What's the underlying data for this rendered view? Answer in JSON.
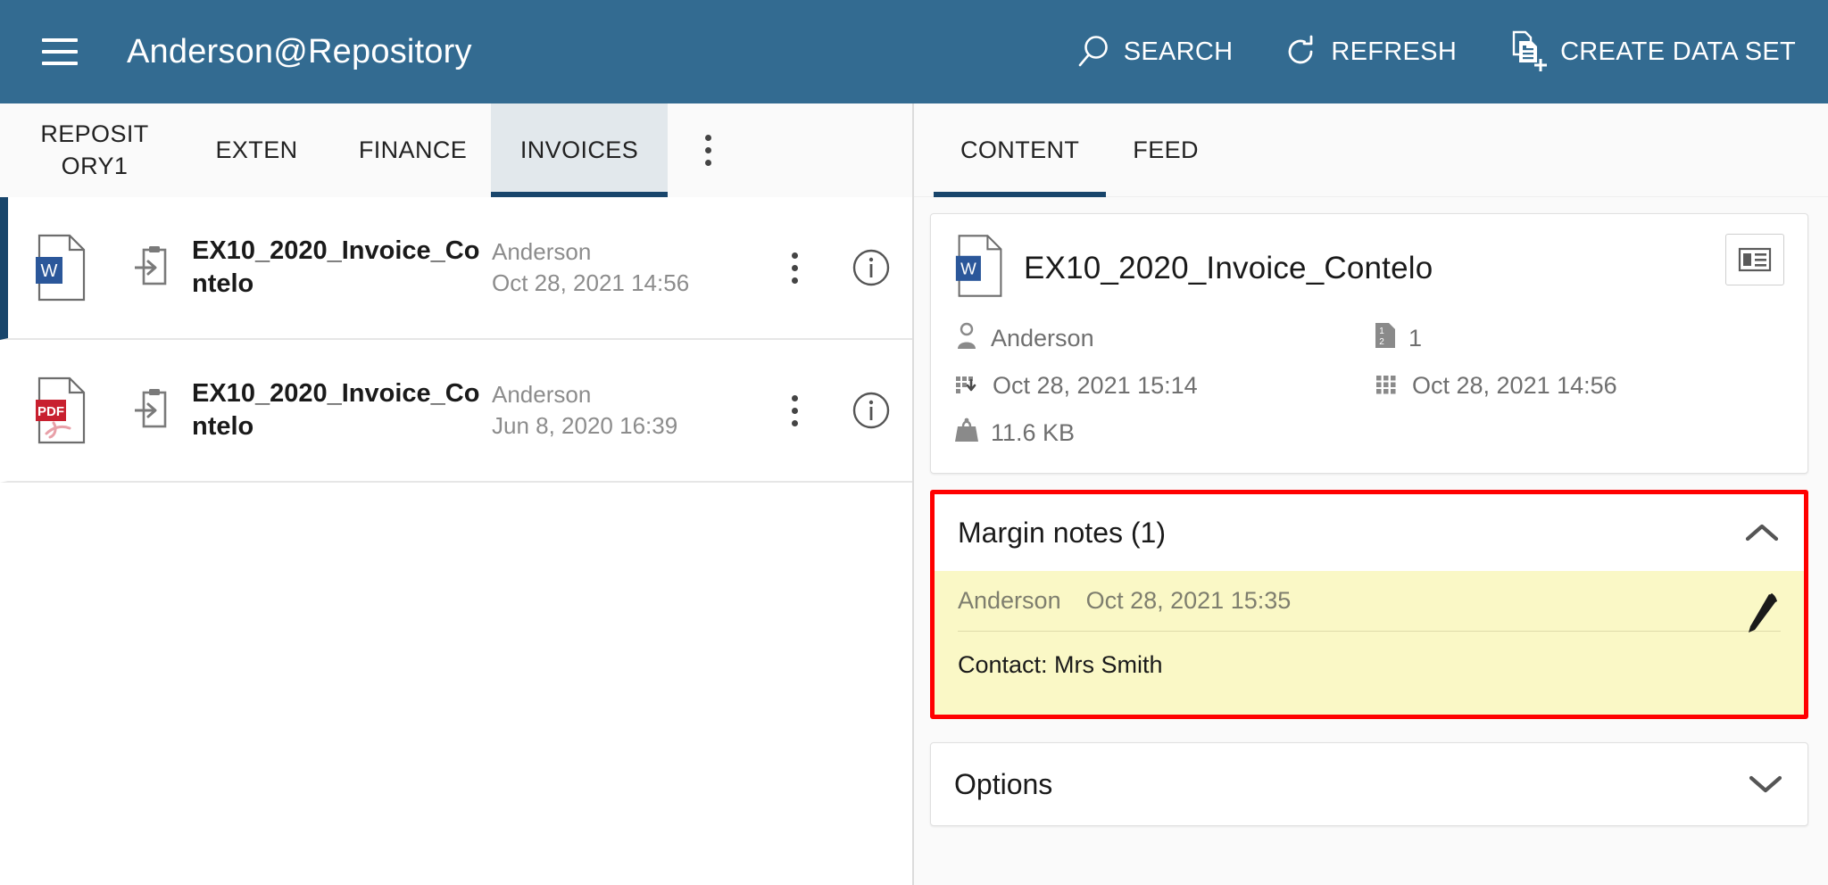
{
  "app": {
    "title": "Anderson@Repository",
    "menu_icon": "hamburger-icon",
    "actions": [
      {
        "label": "SEARCH",
        "icon": "search-icon"
      },
      {
        "label": "REFRESH",
        "icon": "refresh-icon"
      },
      {
        "label": "CREATE DATA SET",
        "icon": "create-data-set-icon"
      }
    ],
    "header_color": "#336B91",
    "accent_color": "#18456B",
    "highlight_color": "#FF0000",
    "note_color": "#FAF8C6"
  },
  "left_pane": {
    "tabs": [
      {
        "label": "REPOSITORY1",
        "active": false
      },
      {
        "label": "EXTEN",
        "active": false
      },
      {
        "label": "FINANCE",
        "active": false
      },
      {
        "label": "INVOICES",
        "active": true
      }
    ],
    "overflow_icon": "more-vertical-icon",
    "files": [
      {
        "type_icon": "word-file-icon",
        "type_label": "W",
        "state_icon": "check-in-icon",
        "name": "EX10_2020_Invoice_Contelo",
        "author": "Anderson",
        "modified": "Oct 28, 2021 14:56",
        "selected": true
      },
      {
        "type_icon": "pdf-file-icon",
        "type_label": "PDF",
        "state_icon": "check-in-icon",
        "name": "EX10_2020_Invoice_Contelo",
        "author": "Anderson",
        "modified": "Jun 8, 2020 16:39",
        "selected": false
      }
    ]
  },
  "right_pane": {
    "tabs": [
      {
        "label": "CONTENT",
        "active": true
      },
      {
        "label": "FEED",
        "active": false
      }
    ],
    "detail": {
      "type_icon": "word-file-icon",
      "type_label": "W",
      "title": "EX10_2020_Invoice_Contelo",
      "view_toggle_icon": "list-view-icon",
      "metadata": [
        {
          "icon": "user-icon",
          "value": "Anderson"
        },
        {
          "icon": "version-icon",
          "value": "1"
        },
        {
          "icon": "checked-in-date-icon",
          "value": "Oct 28, 2021 15:14"
        },
        {
          "icon": "modified-date-icon",
          "value": "Oct 28, 2021 14:56"
        },
        {
          "icon": "file-size-icon",
          "value": "11.6 KB"
        }
      ]
    },
    "margin_notes": {
      "title": "Margin notes (1)",
      "expanded": true,
      "collapse_icon": "chevron-up-icon",
      "note": {
        "author": "Anderson",
        "timestamp": "Oct 28, 2021 15:35",
        "text": "Contact: Mrs Smith",
        "edit_icon": "pencil-icon"
      }
    },
    "options": {
      "title": "Options",
      "expanded": false,
      "expand_icon": "chevron-down-icon"
    }
  }
}
